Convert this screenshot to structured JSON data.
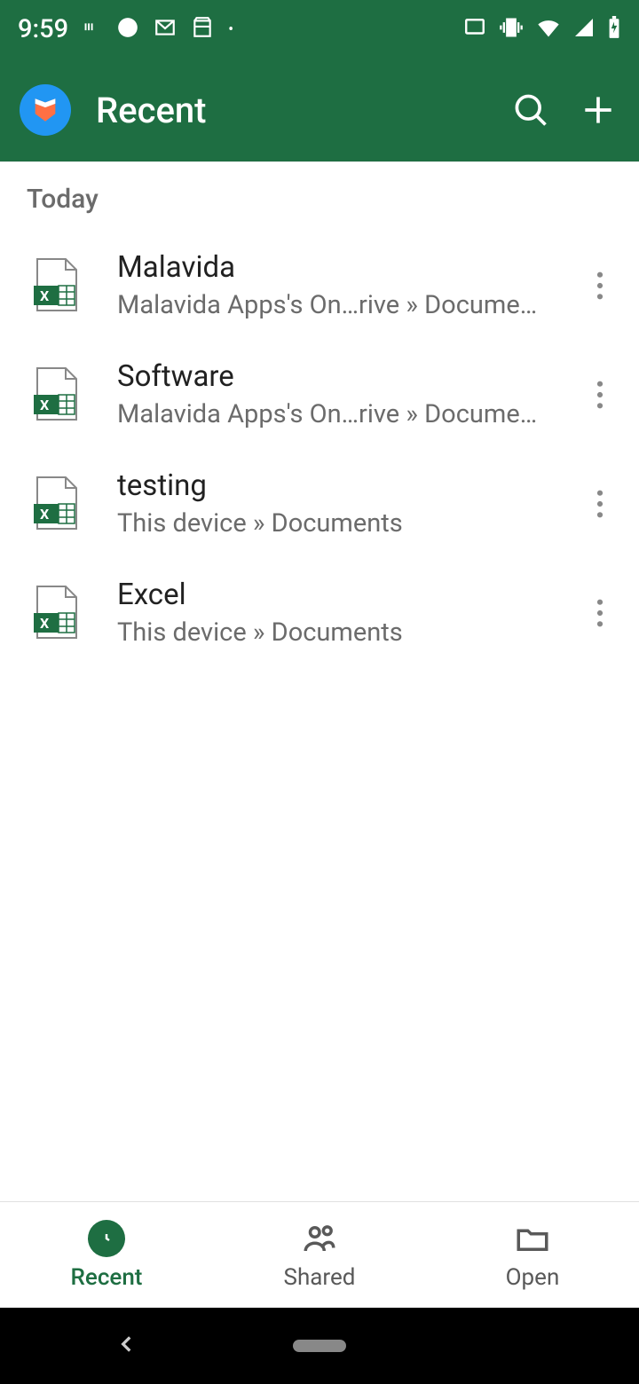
{
  "status": {
    "time": "9:59"
  },
  "appbar": {
    "title": "Recent"
  },
  "section": {
    "today": "Today"
  },
  "files": [
    {
      "name": "Malavida",
      "location": "Malavida Apps's On…rive » Documents"
    },
    {
      "name": "Software",
      "location": "Malavida Apps's On…rive » Documents"
    },
    {
      "name": "testing",
      "location": "This device » Documents"
    },
    {
      "name": "Excel",
      "location": "This device » Documents"
    }
  ],
  "nav": {
    "recent": "Recent",
    "shared": "Shared",
    "open": "Open"
  }
}
